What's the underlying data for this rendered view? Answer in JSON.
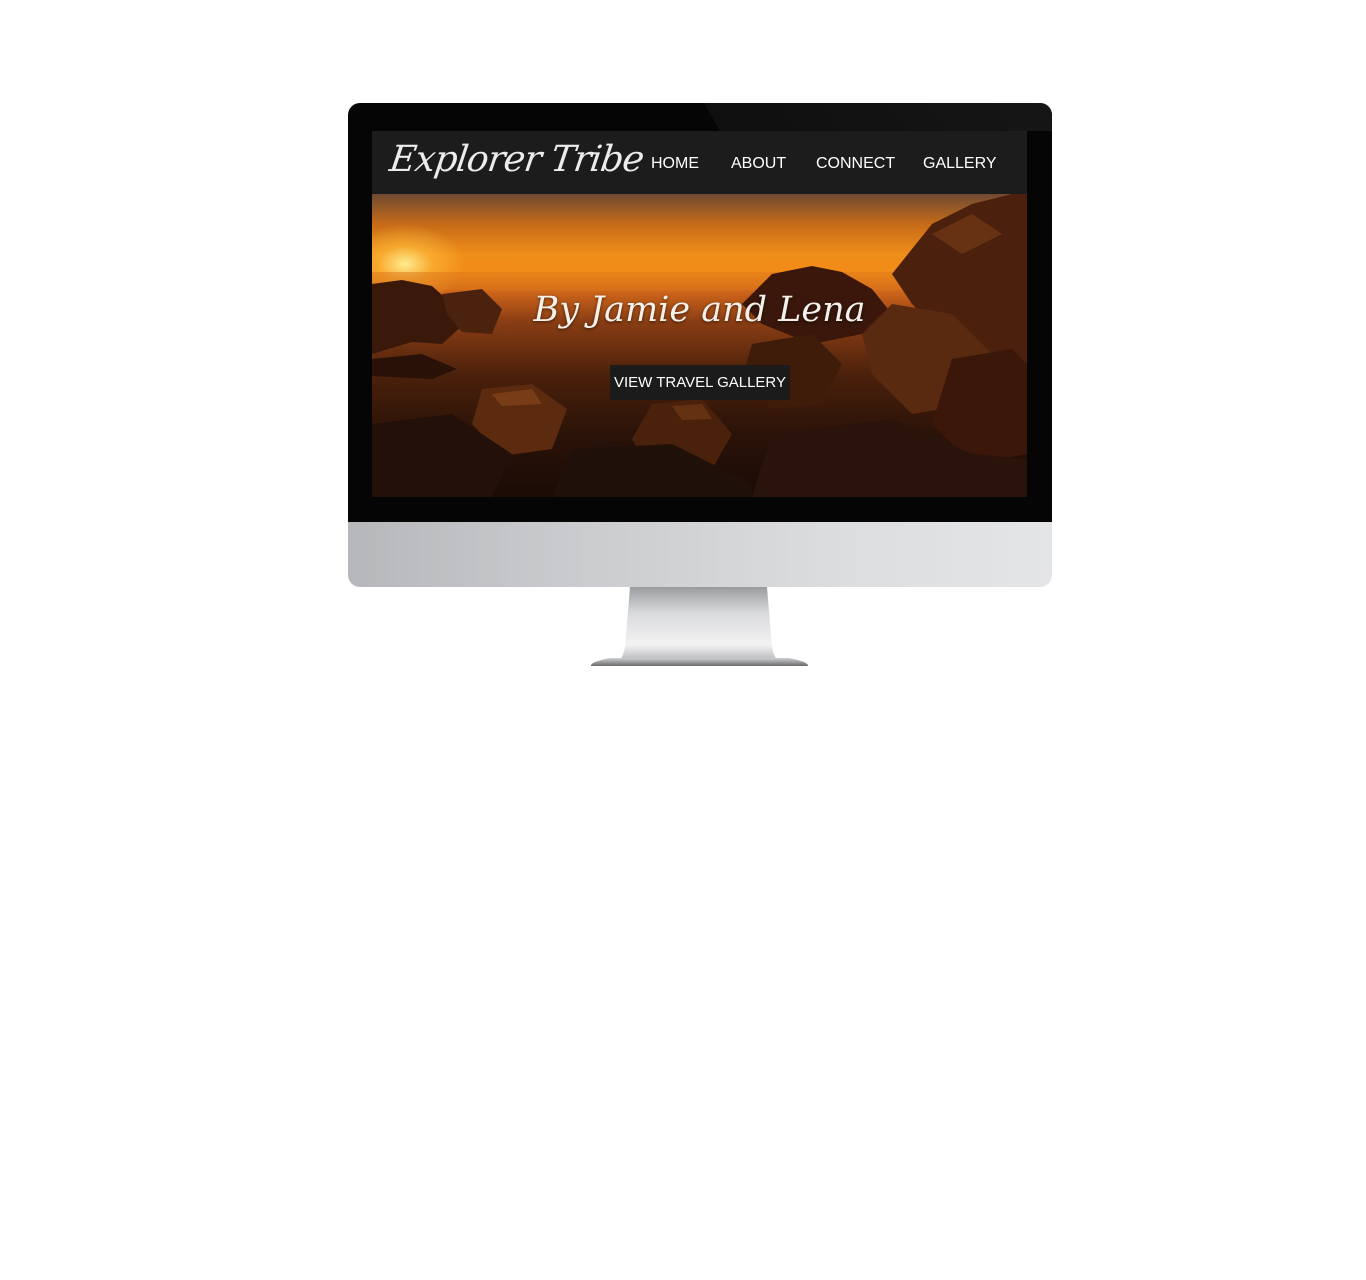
{
  "site": {
    "logo": "Explorer Tribe",
    "nav": [
      {
        "label": "HOME"
      },
      {
        "label": "ABOUT"
      },
      {
        "label": "CONNECT"
      },
      {
        "label": "GALLERY"
      }
    ],
    "hero": {
      "tagline": "By Jamie and Lena",
      "cta_label": "VIEW TRAVEL GALLERY"
    }
  },
  "colors": {
    "header_bg": "#1c1c1c",
    "cta_bg": "#1b1b1b",
    "text": "#ffffff",
    "sky_orange": "#f08e1a"
  }
}
